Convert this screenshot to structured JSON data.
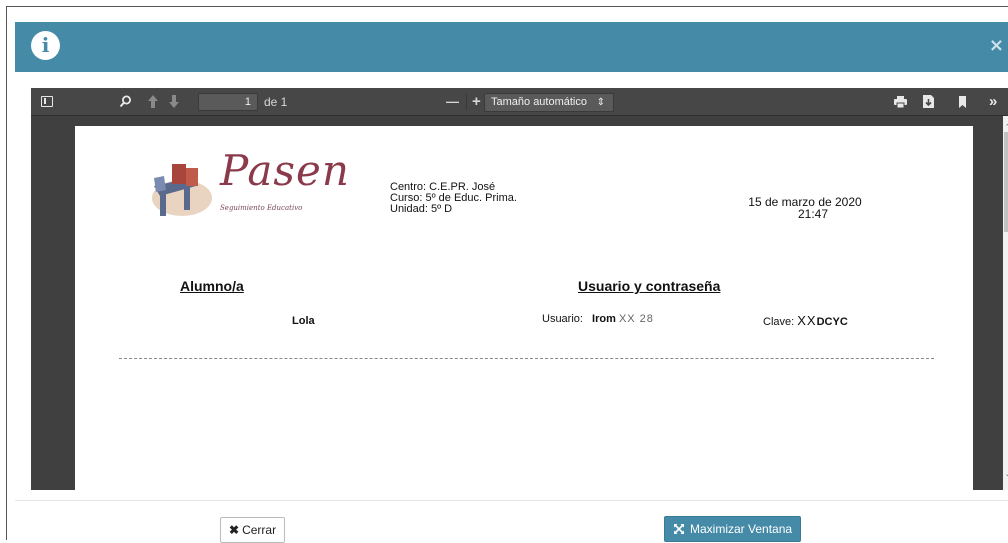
{
  "header": {
    "info_icon": "info-icon",
    "close_label": "×"
  },
  "viewer": {
    "toolbar": {
      "page_current": "1",
      "page_total_label": "de 1",
      "zoom_minus": "—",
      "zoom_plus": "+",
      "zoom_value": "Tamaño automático",
      "zoom_caret": "⇕",
      "more_label": "»"
    }
  },
  "document": {
    "logo_text": "Pasen",
    "logo_subtitle": "Seguimiento Educativo",
    "centro": "Centro: C.E.PR. José",
    "curso": "Curso: 5º de Educ. Prima.",
    "unidad": "Unidad: 5º D",
    "date": "15 de marzo de 2020",
    "time": "21:47",
    "col_alumno": "Alumno/a",
    "col_usuario": "Usuario y contraseña",
    "student_name": "Lola",
    "usuario_label": "Usuario:",
    "usuario_value": "Irom",
    "usuario_mask": "XX 28",
    "clave_label": "Clave:",
    "clave_mask": "XX",
    "clave_value": "DCYC"
  },
  "footer": {
    "close_button": "Cerrar",
    "maximize_button": "Maximizar Ventana"
  },
  "colors": {
    "header": "#458ba8",
    "toolbar": "#474747",
    "viewer_bg": "#404040",
    "logo": "#8a3a4a"
  }
}
